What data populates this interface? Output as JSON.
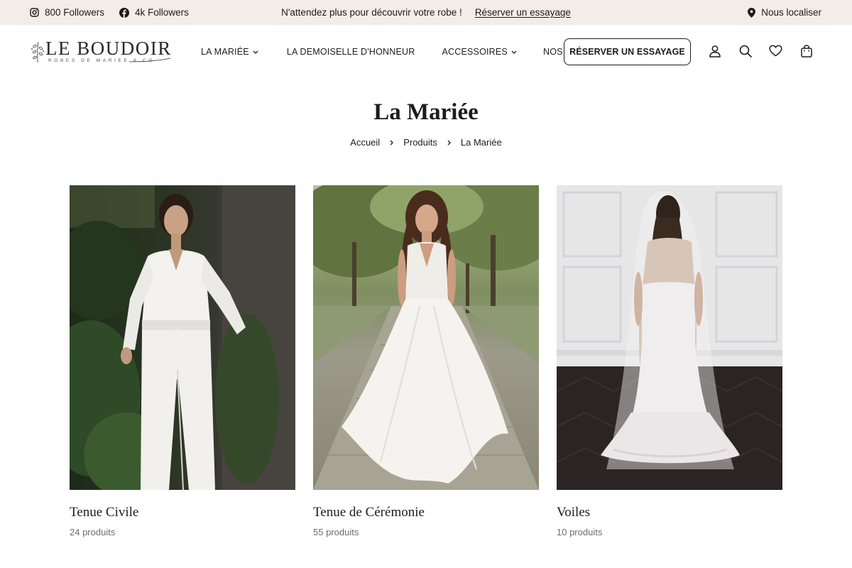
{
  "topbar": {
    "instagram_followers": "800 Followers",
    "facebook_followers": "4k Followers",
    "promo_text": "N'attendez plus pour découvrir votre robe !",
    "promo_link": "Réserver un essayage",
    "locate": "Nous localiser",
    "background": "#f3ece7"
  },
  "logo": {
    "name": "LE BOUDOIR",
    "tagline": "ROBES DE MARIEE & CO"
  },
  "nav": {
    "items": [
      {
        "label": "LA MARIÉE",
        "has_dropdown": true
      },
      {
        "label": "LA DEMOISELLE D'HONNEUR",
        "has_dropdown": false
      },
      {
        "label": "ACCESSOIRES",
        "has_dropdown": true
      },
      {
        "label": "NOS MARIÉES",
        "has_dropdown": false
      }
    ],
    "cta": "RÉSERVER UN ESSAYAGE",
    "icons": [
      "account-icon",
      "search-icon",
      "heart-icon",
      "bag-icon"
    ]
  },
  "page": {
    "title": "La Mariée",
    "breadcrumb": [
      "Accueil",
      "Produits",
      "La Mariée"
    ]
  },
  "categories": [
    {
      "name": "Tenue Civile",
      "count": "24 produits",
      "image": "woman-in-white-jumpsuit-photo"
    },
    {
      "name": "Tenue de Cérémonie",
      "count": "55 produits",
      "image": "woman-in-white-lace-gown-photo"
    },
    {
      "name": "Voiles",
      "count": "10 produits",
      "image": "bride-with-veil-back-view-photo"
    }
  ]
}
